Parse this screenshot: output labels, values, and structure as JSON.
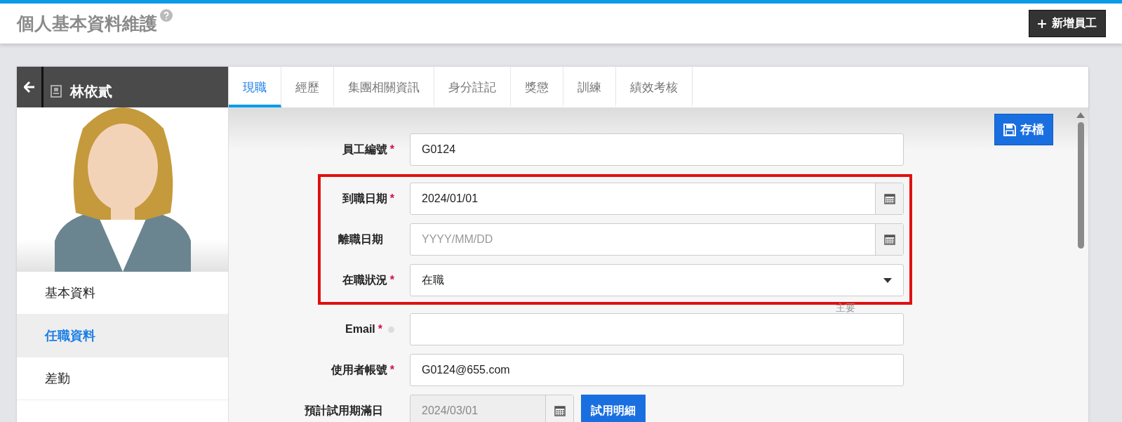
{
  "required_mark": "*",
  "header": {
    "title": "個人基本資料維護",
    "add_button": "新增員工"
  },
  "employee": {
    "name": "林依貳"
  },
  "sidebar": {
    "items": [
      {
        "label": "基本資料",
        "selected": false
      },
      {
        "label": "任職資料",
        "selected": true
      },
      {
        "label": "差勤",
        "selected": false
      }
    ]
  },
  "tabs": [
    {
      "label": "現職",
      "selected": true
    },
    {
      "label": "經歷",
      "selected": false
    },
    {
      "label": "集團相關資訊",
      "selected": false
    },
    {
      "label": "身分註記",
      "selected": false
    },
    {
      "label": "獎懲",
      "selected": false
    },
    {
      "label": "訓練",
      "selected": false
    },
    {
      "label": "績效考核",
      "selected": false
    }
  ],
  "save_button": "存檔",
  "form": {
    "fields": [
      {
        "kind": "text",
        "label": "員工編號",
        "required": true,
        "value": "G0124",
        "highlighted": false
      },
      {
        "kind": "date",
        "label": "到職日期",
        "required": true,
        "value": "2024/01/01",
        "highlighted": true
      },
      {
        "kind": "date",
        "label": "離職日期",
        "required": false,
        "placeholder": "YYYY/MM/DD",
        "highlighted": true
      },
      {
        "kind": "select",
        "label": "在職狀況",
        "required": true,
        "value": "在職",
        "highlighted": true
      },
      {
        "kind": "email",
        "label": "Email",
        "required": true,
        "hint": "主要",
        "highlighted": false
      },
      {
        "kind": "text",
        "label": "使用者帳號",
        "required": true,
        "value": "G0124@655.com",
        "highlighted": false
      },
      {
        "kind": "date",
        "label": "預計試用期滿日",
        "required": false,
        "value": "2024/03/01",
        "disabled": true,
        "button": "試用明細",
        "highlighted": false
      }
    ]
  }
}
